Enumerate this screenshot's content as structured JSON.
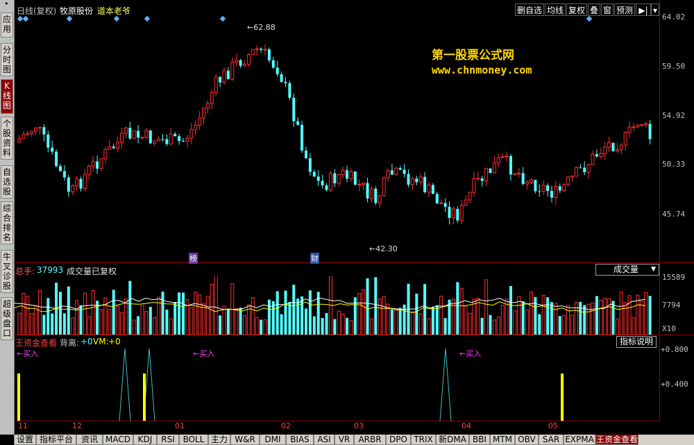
{
  "sidebar": {
    "arrow": "▸",
    "tabs": [
      {
        "label": "应用",
        "active": false
      },
      {
        "label": "分时图",
        "active": false
      },
      {
        "label": "K线图",
        "active": true
      },
      {
        "label": "个股资料",
        "active": false
      },
      {
        "label": "自选股",
        "active": false
      },
      {
        "label": "综合排名",
        "active": false
      },
      {
        "label": "牛叉诊股",
        "active": false
      },
      {
        "label": "超级盘口",
        "active": false
      }
    ]
  },
  "header": {
    "period": "日线(复权)",
    "stock": "牧原股份",
    "indicator_name": "道本老爷"
  },
  "toolbar": {
    "delete_watch": "删自选",
    "ma": "均线",
    "restore": "复权",
    "overlay": "叠",
    "window": "窗",
    "forecast": "预测",
    "play": "▶|",
    "menu": "▾"
  },
  "price_axis": [
    "64.02",
    "59.50",
    "54.92",
    "50.33",
    "45.74"
  ],
  "annotations": {
    "high": "←62.88",
    "low": "←42.30",
    "bang": "榜",
    "cai": "财"
  },
  "watermark": {
    "line1": "第一股票公式网",
    "line2": "www.chnmoney.com"
  },
  "volume": {
    "label": "总手:",
    "value": "37993",
    "desc": "成交量已复权",
    "dropdown": "成交量",
    "axis": [
      "15589",
      "7794"
    ],
    "unit": "X10"
  },
  "indicator": {
    "name": "王资金查看",
    "divergence_label": "背离:",
    "divergence_value": "+0",
    "vm_label": "VM:",
    "vm_value": "+0",
    "explain_button": "指标说明",
    "axis": [
      "+0.800",
      "+0.400"
    ],
    "buy_label": "←买入"
  },
  "colors": {
    "up": "#ff3030",
    "down": "#54ffff",
    "frame": "#a00000",
    "signal": "#ffff00",
    "buy": "#ff40ff"
  },
  "time_axis": [
    "11",
    "12",
    "01",
    "02",
    "03",
    "04",
    "05"
  ],
  "bottom_tabs": [
    {
      "label": "设置",
      "active": false
    },
    {
      "label": "指标平台",
      "active": false
    },
    {
      "label": "资讯",
      "active": false
    },
    {
      "label": "MACD",
      "active": false
    },
    {
      "label": "KDJ",
      "active": false
    },
    {
      "label": "RSI",
      "active": false
    },
    {
      "label": "BOLL",
      "active": false
    },
    {
      "label": "主力",
      "active": false
    },
    {
      "label": "W&R",
      "active": false
    },
    {
      "label": "DMI",
      "active": false
    },
    {
      "label": "BIAS",
      "active": false
    },
    {
      "label": "ASI",
      "active": false
    },
    {
      "label": "VR",
      "active": false
    },
    {
      "label": "ARBR",
      "active": false
    },
    {
      "label": "DPO",
      "active": false
    },
    {
      "label": "TRIX",
      "active": false
    },
    {
      "label": "新DMA",
      "active": false
    },
    {
      "label": "BBI",
      "active": false
    },
    {
      "label": "MTM",
      "active": false
    },
    {
      "label": "OBV",
      "active": false
    },
    {
      "label": "SAR",
      "active": false
    },
    {
      "label": "EXPMA",
      "active": false
    },
    {
      "label": "王资金查看",
      "active": true
    }
  ]
}
